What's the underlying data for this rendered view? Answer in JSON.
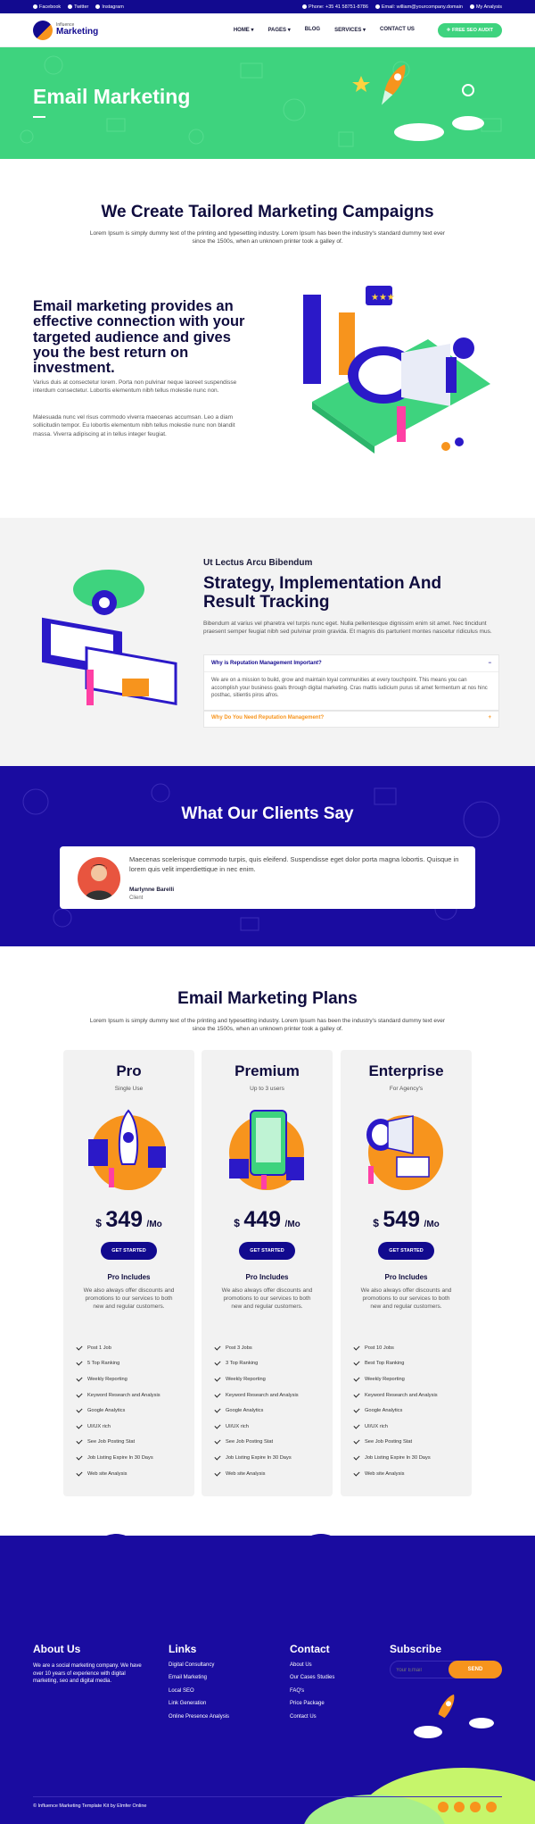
{
  "topbar": {
    "social": [
      "Facebook",
      "Twitter",
      "Instagram"
    ],
    "phone": "Phone: +35 41 58751-8786",
    "email": "Email: william@yourcompany.domain",
    "account": "My Analysis"
  },
  "nav": {
    "logo_small": "Influence",
    "logo_big": "Marketing",
    "items": [
      "HOME ▾",
      "PAGES ▾",
      "BLOG",
      "SERVICES ▾",
      "CONTACT US"
    ],
    "cta": "FREE SEO AUDIT"
  },
  "hero": {
    "title": "Email Marketing"
  },
  "intro": {
    "title": "We Create Tailored Marketing Campaigns",
    "subtitle": "Lorem Ipsum is simply dummy text of the printing and typesetting industry. Lorem Ipsum has been the industry's standard dummy text ever since the 1500s, when an unknown printer took a galley of."
  },
  "feature": {
    "heading": "Email marketing provides an effective connection with your targeted audience and gives you the best return on investment.",
    "p1": "Varius duis at consectetur lorem. Porta non pulvinar neque laoreet suspendisse interdum consectetur. Lobortis elementum nibh tellus molestie nunc non.",
    "p2": "Malesuada nunc vel risus commodo viverra maecenas accumsan. Leo a diam sollicitudin tempor. Eu lobortis elementum nibh tellus molestie nunc non blandit massa. Viverra adipiscing at in tellus integer feugiat."
  },
  "strategy": {
    "kicker": "Ut Lectus Arcu Bibendum",
    "title": "Strategy, Implementation And Result Tracking",
    "text": "Bibendum at varius vel pharetra vel turpis nunc eget. Nulla pellentesque dignissim enim sit amet. Nec tincidunt praesent semper feugiat nibh sed pulvinar proin gravida. Et magnis dis parturient montes nascetur ridiculus mus.",
    "accordion": [
      {
        "q": "Why is Reputation Management Important?",
        "a": "We are on a mission to build, grow and maintain loyal communities at every touchpoint. This means you can accomplish your business goals through digital marketing. Cras mattis iudicium purus sit amet fermentum at nos hinc posthac, sitientis piros afros.",
        "toggle": "−"
      },
      {
        "q": "Why Do You Need Reputation Management?",
        "toggle": "+"
      }
    ]
  },
  "testimonials": {
    "title": "What Our Clients Say",
    "quote": "Maecenas scelerisque commodo turpis, quis eleifend. Suspendisse eget dolor porta magna lobortis. Quisque in lorem quis velit imperdiettique in nec enim.",
    "name": "Marlynne Barelli",
    "role": "Client"
  },
  "plans": {
    "title": "Email Marketing Plans",
    "subtitle": "Lorem Ipsum is simply dummy text of the printing and typesetting industry. Lorem Ipsum has been the industry's standard dummy text ever since the 1500s, when an unknown printer took a galley of.",
    "items": [
      {
        "name": "Pro",
        "sub": "Single Use",
        "currency": "$",
        "price": "349",
        "per": "/Mo",
        "button": "GET STARTED",
        "includes": "Pro Includes",
        "desc": "We also always offer discounts and promotions to our services to both new and regular customers.",
        "features": [
          "Post 1 Job",
          "5 Top Ranking",
          "Weekly Reporting",
          "Keyword Research and Analysis",
          "Google Analytics",
          "UI/UX rich",
          "See Job Posting Stat",
          "Job Listing Expire In 30 Days",
          "Web site Analysis"
        ]
      },
      {
        "name": "Premium",
        "sub": "Up to 3 users",
        "currency": "$",
        "price": "449",
        "per": "/Mo",
        "button": "GET STARTED",
        "includes": "Pro Includes",
        "desc": "We also always offer discounts and promotions to our services to both new and regular customers.",
        "features": [
          "Post 3 Jobs",
          "3 Top Ranking",
          "Weekly Reporting",
          "Keyword Research and Analysis",
          "Google Analytics",
          "UI/UX rich",
          "See Job Posting Stat",
          "Job Listing Expire In 30 Days",
          "Web site Analysis"
        ]
      },
      {
        "name": "Enterprise",
        "sub": "For Agency's",
        "currency": "$",
        "price": "549",
        "per": "/Mo",
        "button": "GET STARTED",
        "includes": "Pro Includes",
        "desc": "We also always offer discounts and promotions to our services to both new and regular customers.",
        "features": [
          "Post 10 Jobs",
          "Best Top Ranking",
          "Weekly Reporting",
          "Keyword Research and Analysis",
          "Google Analytics",
          "UI/UX rich",
          "See Job Posting Stat",
          "Job Listing Expire In 30 Days",
          "Web site Analysis"
        ]
      }
    ]
  },
  "footer": {
    "about_title": "About Us",
    "about_text": "We are a social marketing company. We have over 10 years of experience with digital marketing, seo and digital media.",
    "links_title": "Links",
    "links": [
      "Digital Consultancy",
      "Email Marketing",
      "Local SEO",
      "Link Generation",
      "Online Presence Analysis"
    ],
    "contact_title": "Contact",
    "contact": [
      "About Us",
      "Our Cases Studies",
      "FAQ's",
      "Price Package",
      "Contact Us"
    ],
    "subscribe_title": "Subscribe",
    "subscribe_placeholder": "Your Email",
    "subscribe_button": "SEND",
    "copyright": "© Influence Marketing Template Kit by Elmfer Online"
  },
  "colors": {
    "brand": "#120a8f",
    "green": "#3ed37e",
    "orange": "#f7941d"
  }
}
